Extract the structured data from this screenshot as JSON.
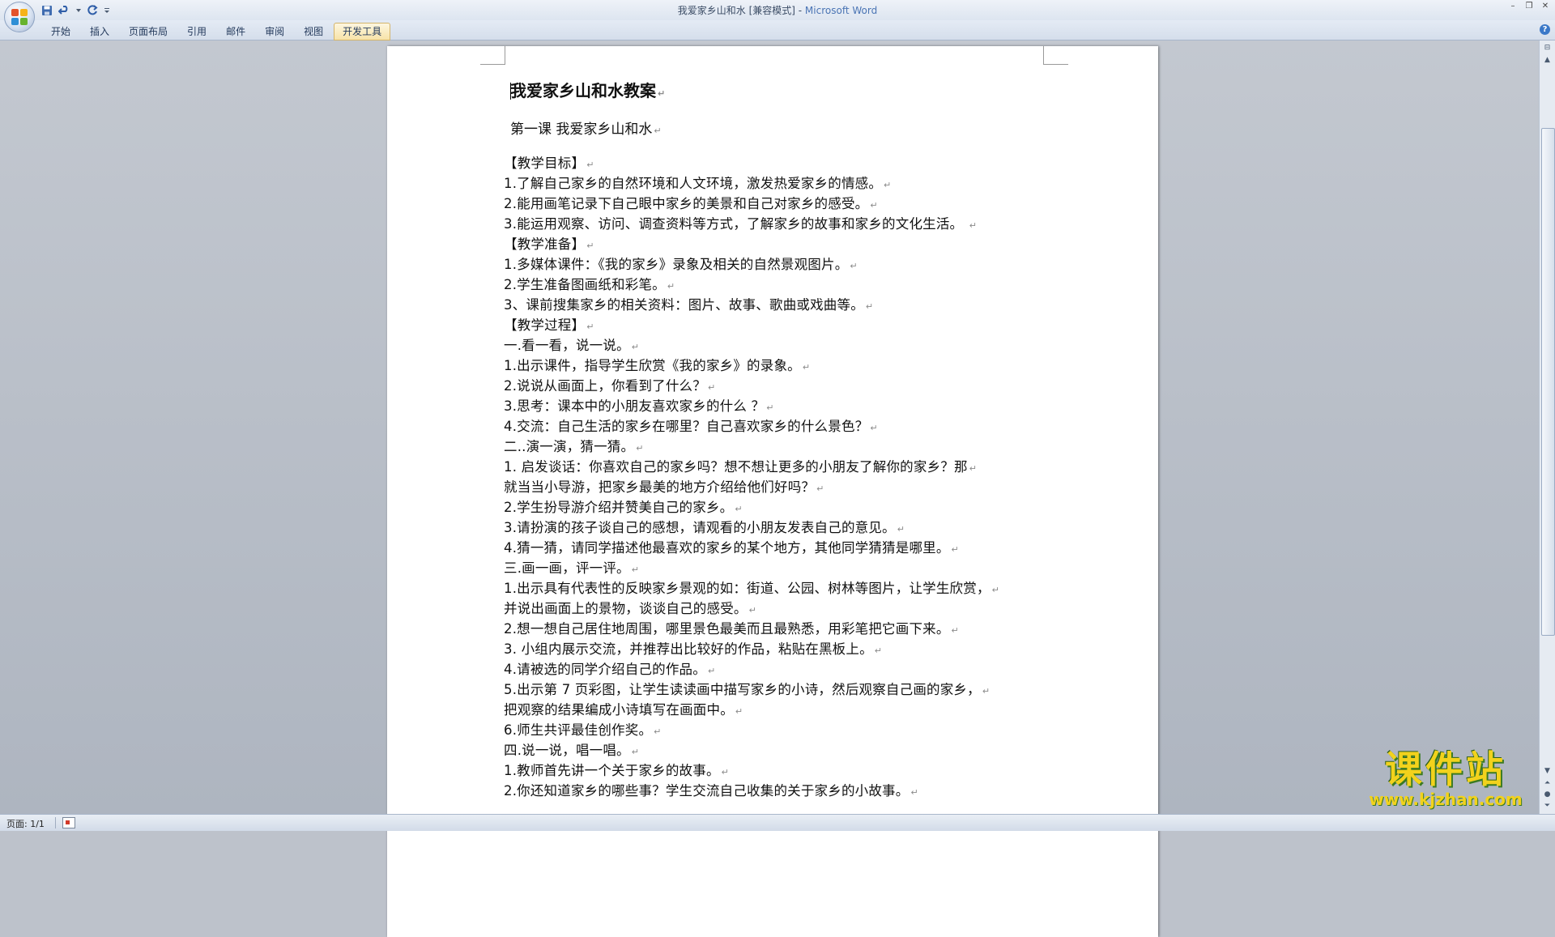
{
  "window": {
    "doc_name": "我爱家乡山和水 [兼容模式] - ",
    "app_name": "Microsoft Word"
  },
  "ribbon": {
    "tabs": [
      "开始",
      "插入",
      "页面布局",
      "引用",
      "邮件",
      "审阅",
      "视图",
      "开发工具"
    ],
    "active_tab": "开发工具"
  },
  "document": {
    "title": "我爱家乡山和水教案",
    "lesson_title": "第一课  我爱家乡山和水",
    "lines": [
      "【教学目标】",
      "1.了解自己家乡的自然环境和人文环境，激发热爱家乡的情感。",
      "2.能用画笔记录下自己眼中家乡的美景和自己对家乡的感受。",
      "3.能运用观察、访问、调查资料等方式，了解家乡的故事和家乡的文化生活。  ",
      "【教学准备】",
      "1.多媒体课件：《我的家乡》录象及相关的自然景观图片。",
      "2.学生准备图画纸和彩笔。",
      "3、课前搜集家乡的相关资料：图片、故事、歌曲或戏曲等。",
      "【教学过程】",
      "一.看一看，说一说。",
      "1.出示课件，指导学生欣赏《我的家乡》的录象。",
      "2.说说从画面上，你看到了什么？",
      "3.思考：课本中的小朋友喜欢家乡的什么 ？",
      "4.交流：自己生活的家乡在哪里？自己喜欢家乡的什么景色？",
      "二..演一演，猜一猜。",
      "1. 启发谈话：你喜欢自己的家乡吗？想不想让更多的小朋友了解你的家乡？那",
      "就当当小导游，把家乡最美的地方介绍给他们好吗？",
      "2.学生扮导游介绍并赞美自己的家乡。",
      "3.请扮演的孩子谈自己的感想，请观看的小朋友发表自己的意见。",
      "4.猜一猜，请同学描述他最喜欢的家乡的某个地方，其他同学猜猜是哪里。",
      "三.画一画，评一评。",
      "1.出示具有代表性的反映家乡景观的如：街道、公园、树林等图片，让学生欣赏，",
      "并说出画面上的景物，谈谈自己的感受。",
      "2.想一想自己居住地周围，哪里景色最美而且最熟悉，用彩笔把它画下来。",
      "3. 小组内展示交流，并推荐出比较好的作品，粘贴在黑板上。",
      "4.请被选的同学介绍自己的作品。",
      "5.出示第 7 页彩图，让学生读读画中描写家乡的小诗，然后观察自己画的家乡，",
      "把观察的结果编成小诗填写在画面中。",
      "6.师生共评最佳创作奖。",
      "四.说一说，唱一唱。",
      "1.教师首先讲一个关于家乡的故事。",
      "2.你还知道家乡的哪些事？学生交流自己收集的关于家乡的小故事。"
    ]
  },
  "statusbar": {
    "page_count": "页面: 1/1"
  },
  "watermark": {
    "text": "课件站",
    "url": "www.kjzhan.com"
  }
}
